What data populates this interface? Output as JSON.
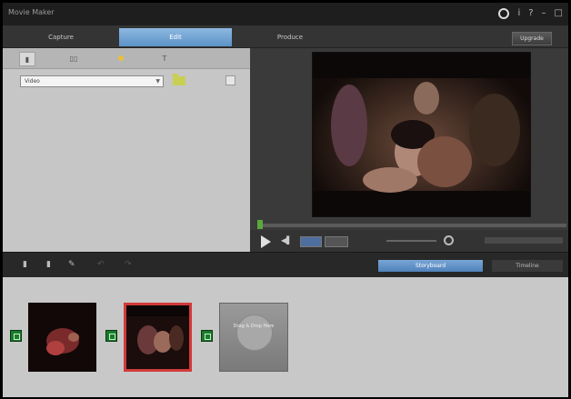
{
  "app": {
    "title": "Movie Maker"
  },
  "tabs": [
    {
      "label": "Capture",
      "active": false
    },
    {
      "label": "Edit",
      "active": true
    },
    {
      "label": "Produce",
      "active": false
    }
  ],
  "header": {
    "upgrade_label": "Upgrade"
  },
  "left_panel": {
    "dropdown_value": "Video"
  },
  "storyboard_bar": {
    "storyboard_label": "Storyboard",
    "timeline_label": "Timeline"
  },
  "storyboard": {
    "add_media_label": "Drag & Drop Here"
  },
  "colors": {
    "accent": "#5c93c8",
    "selected_clip_border": "#d23a3a",
    "transition": "#1a7a2c"
  }
}
